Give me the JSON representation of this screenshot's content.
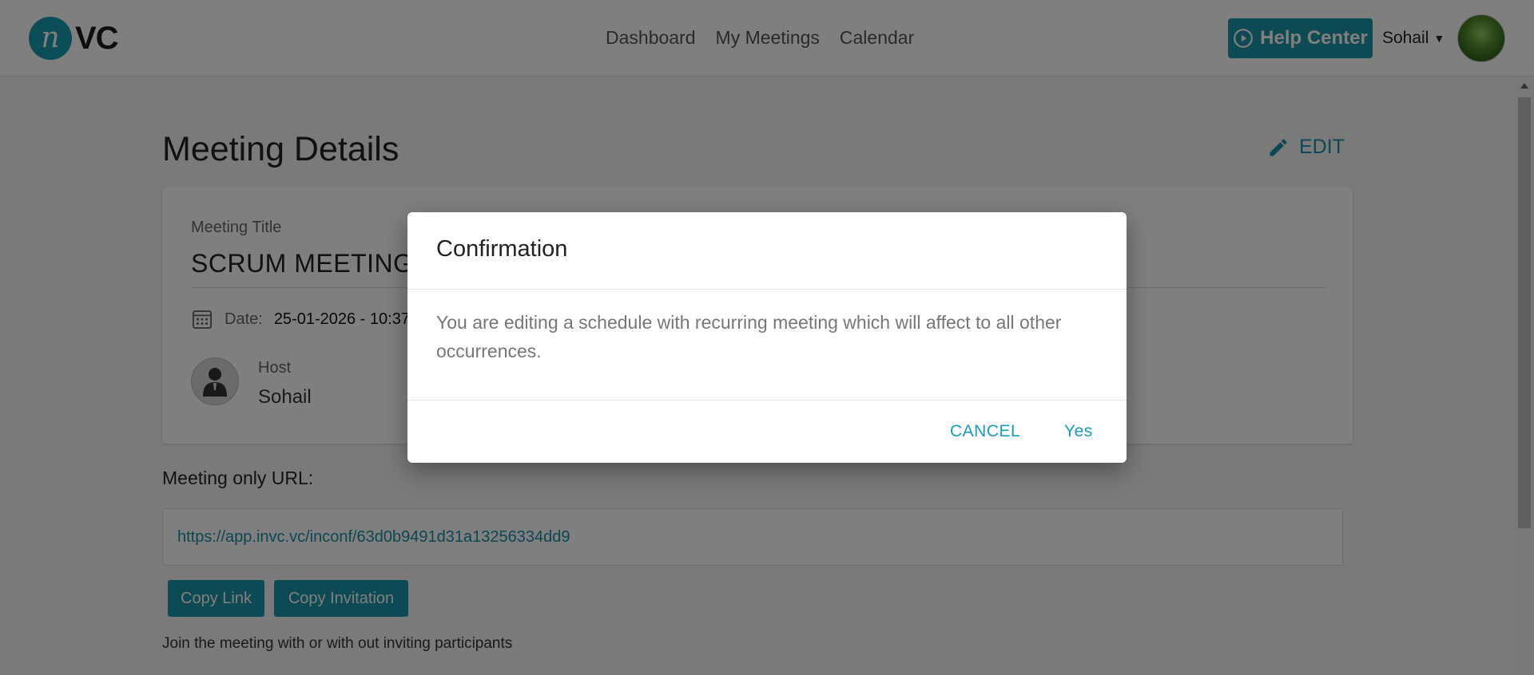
{
  "header": {
    "logo_mark": "n",
    "logo_text": "VC",
    "nav": [
      "Dashboard",
      "My Meetings",
      "Calendar"
    ],
    "help_label": "Help Center",
    "user_name": "Sohail"
  },
  "page": {
    "title": "Meeting Details",
    "edit_label": "EDIT"
  },
  "meeting": {
    "title_label": "Meeting Title",
    "title_value": "SCRUM MEETING",
    "date_label": "Date:",
    "date_value": "25-01-2026 - 10:37",
    "host_label": "Host",
    "host_value": "Sohail"
  },
  "url_section": {
    "label": "Meeting only URL:",
    "url": "https://app.invc.vc/inconf/63d0b9491d31a13256334dd9",
    "copy_link_label": "Copy Link",
    "copy_invitation_label": "Copy Invitation",
    "join_text": "Join the meeting with or with out inviting participants"
  },
  "dialog": {
    "title": "Confirmation",
    "message": "You are editing a schedule with recurring meeting which will affect to all other occurrences.",
    "cancel_label": "CANCEL",
    "yes_label": "Yes"
  },
  "colors": {
    "accent": "#1a95a8",
    "link": "#1a8ea3",
    "dialog_button": "#1a9cc0",
    "overlay": "rgba(0,0,0,0.5)"
  },
  "icons": [
    "play-circle-icon",
    "caret-down-icon",
    "pencil-icon",
    "calendar-icon",
    "user-icon"
  ]
}
